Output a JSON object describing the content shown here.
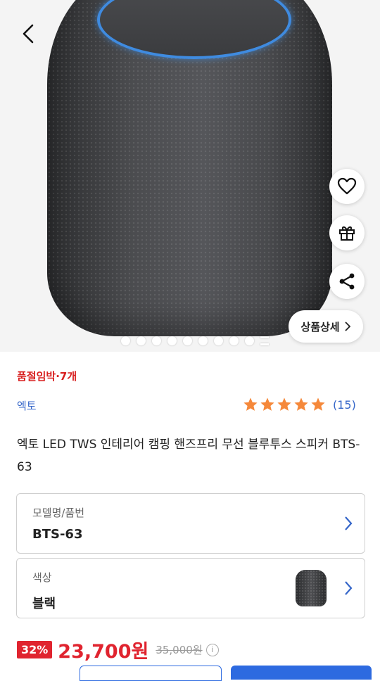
{
  "hero": {
    "detail_button_label": "상품상세",
    "image_count": 10,
    "active_index": 9
  },
  "product": {
    "stock_notice": "품절임박·7개",
    "brand": "엑토",
    "rating": 5,
    "review_count": "(15)",
    "title": "엑토 LED TWS 인테리어 캠핑 핸즈프리 무선 블루투스 스피커 BTS-63"
  },
  "options": [
    {
      "label": "모델명/품번",
      "value": "BTS-63"
    },
    {
      "label": "색상",
      "value": "블랙"
    }
  ],
  "price": {
    "discount": "32%",
    "current": "23,700원",
    "original": "35,000원",
    "info_glyph": "i"
  },
  "colors": {
    "accent": "#2d6ae0",
    "sale_red": "#e0242f",
    "star": "#f5883a",
    "brand_blue": "#3566c9"
  },
  "icons": {
    "back": "chevron-left-icon",
    "wishlist": "heart-icon",
    "gift": "gift-icon",
    "share": "share-icon"
  }
}
